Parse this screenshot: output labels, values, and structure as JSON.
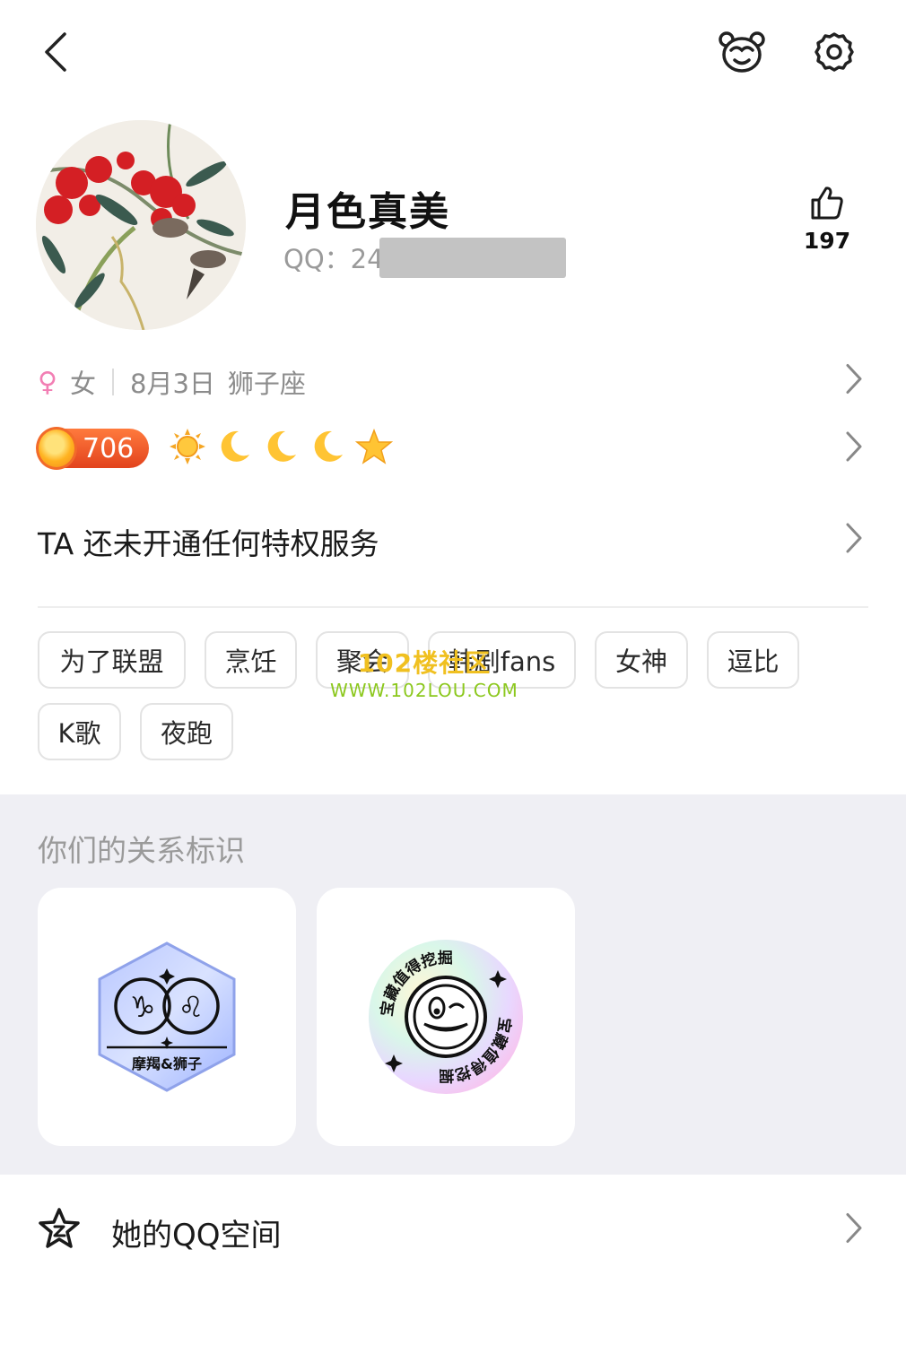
{
  "profile": {
    "name": "月色真美",
    "qq_label": "QQ：24",
    "likes": "197"
  },
  "info": {
    "gender_icon": "♀",
    "gender": "女",
    "birthday": "8月3日",
    "constellation": "狮子座"
  },
  "level": {
    "number": "706",
    "icons": [
      "sun-icon",
      "moon-icon",
      "moon-icon",
      "moon-icon",
      "star-icon"
    ]
  },
  "privilege": {
    "text": "TA 还未开通任何特权服务"
  },
  "tags": [
    "为了联盟",
    "烹饪",
    "聚会",
    "韩剧fans",
    "女神",
    "逗比",
    "K歌",
    "夜跑"
  ],
  "watermark": {
    "line1": "102楼社区",
    "line2": "WWW.102LOU.COM"
  },
  "relationship": {
    "title": "你们的关系标识",
    "badges": [
      {
        "label": "摩羯&狮子"
      },
      {
        "label": "宝藏值得挖掘"
      }
    ]
  },
  "qzone": {
    "label": "她的QQ空间"
  },
  "colors": {
    "gender": "#f27fb4",
    "level_badge": "#e8532a",
    "section_bg": "#efeff4"
  }
}
